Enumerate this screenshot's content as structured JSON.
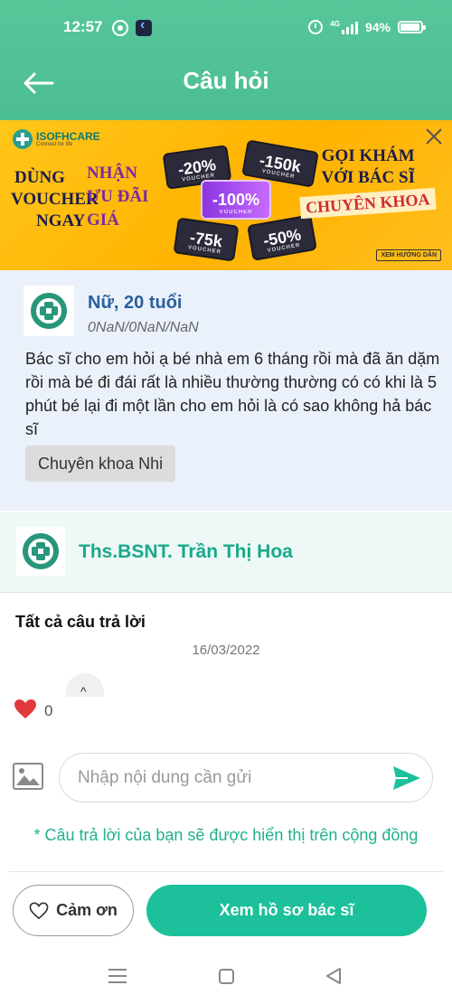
{
  "status_bar": {
    "time": "12:57",
    "signal_text": "4G",
    "battery": "94%"
  },
  "app_bar": {
    "title": "Câu hỏi"
  },
  "banner": {
    "brand_name": "ISOFHCARE",
    "brand_tagline": "Connect for life",
    "left_lines": [
      "DÙNG",
      "VOUCHER",
      "NGAY"
    ],
    "highlight_lines": [
      "NHẬN",
      "ƯU ĐÃI",
      "GIÁ"
    ],
    "vouchers": [
      "-20%",
      "-150k",
      "-100%",
      "-75k",
      "-50%"
    ],
    "voucher_caption": "VOUCHER",
    "right_line1": "GỌI KHÁM",
    "right_line2": "VỚI BÁC SĨ",
    "right_line3": "CHUYÊN KHOA",
    "guide_label": "XEM HƯỚNG DẪN"
  },
  "question": {
    "author": "Nữ, 20 tuổi",
    "date": "0NaN/0NaN/NaN",
    "text": "Bác sĩ cho em hỏi ạ bé nhà em 6 tháng rồi mà đã ăn dặm rồi mà bé đi đái rất là nhiều thường thường có có khi là 5 phút bé lại đi một lần cho em hỏi là có sao không hả bác sĩ",
    "tag": "Chuyên khoa Nhi"
  },
  "doctor": {
    "name": "Ths.BSNT. Trần Thị Hoa"
  },
  "answers": {
    "title": "Tất cả câu trả lời",
    "date": "16/03/2022",
    "collapse_symbol": "^",
    "likes": "0"
  },
  "compose": {
    "placeholder": "Nhập nội dung cần gửi",
    "notice": "* Câu trả lời của bạn sẽ được hiển thị trên cộng đồng"
  },
  "actions": {
    "thanks_label": "Cảm ơn",
    "profile_label": "Xem hồ sơ bác sĩ"
  },
  "colors": {
    "header": "#4cbd93",
    "banner": "#ffb300",
    "accent": "#1cc09a",
    "question_bg": "#eaf1fb",
    "doctor_bg": "#eef9f7",
    "heart": "#e0393e"
  },
  "icons": {
    "back": "arrow-left-icon",
    "close": "close-icon",
    "like": "heart-icon",
    "image": "image-icon",
    "send": "send-icon",
    "thanks": "heart-outline-icon"
  }
}
